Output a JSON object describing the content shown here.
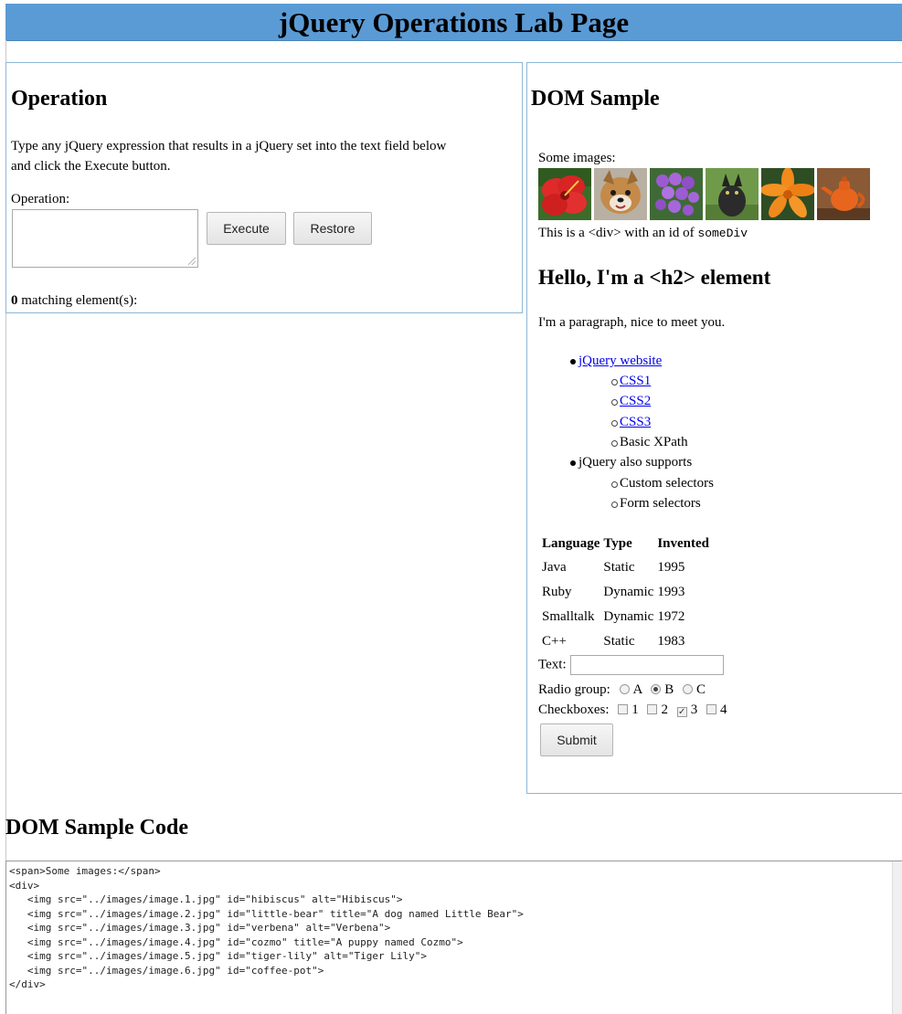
{
  "page": {
    "title": "jQuery Operations Lab Page"
  },
  "operation": {
    "heading": "Operation",
    "description": "Type any jQuery expression that results in a jQuery set into the text field below and click the Execute button.",
    "field_label": "Operation:",
    "field_value": "",
    "execute_label": "Execute",
    "restore_label": "Restore",
    "match_count": "0",
    "match_suffix": " matching element(s):"
  },
  "dom_sample": {
    "heading": "DOM Sample",
    "images_label": "Some images:",
    "images": [
      "hibiscus",
      "little-bear",
      "verbena",
      "cozmo",
      "tiger-lily",
      "coffee-pot"
    ],
    "div_text_prefix": "This is a <div> with an id of ",
    "div_id": "someDiv",
    "h2_text": "Hello, I'm a <h2> element",
    "paragraph": "I'm a paragraph, nice to meet you.",
    "list": {
      "item1": "jQuery website",
      "item1_children": [
        "CSS1",
        "CSS2",
        "CSS3",
        "Basic XPath"
      ],
      "item2": "jQuery also supports",
      "item2_children": [
        "Custom selectors",
        "Form selectors"
      ]
    },
    "table": {
      "headers": [
        "Language",
        "Type",
        "Invented"
      ],
      "rows": [
        [
          "Java",
          "Static",
          "1995"
        ],
        [
          "Ruby",
          "Dynamic",
          "1993"
        ],
        [
          "Smalltalk",
          "Dynamic",
          "1972"
        ],
        [
          "C++",
          "Static",
          "1983"
        ]
      ]
    },
    "form": {
      "text_label": "Text:",
      "text_value": "",
      "radio_label": "Radio group:",
      "radio_options": [
        "A",
        "B",
        "C"
      ],
      "radio_selected": "B",
      "checkbox_label": "Checkboxes:",
      "checkbox_options": [
        "1",
        "2",
        "3",
        "4"
      ],
      "checkbox_checked": [
        "3"
      ],
      "submit_label": "Submit"
    }
  },
  "code": {
    "heading": "DOM Sample Code",
    "lines": [
      "<span>Some images:</span>",
      "<div>",
      "   <img src=\"../images/image.1.jpg\" id=\"hibiscus\" alt=\"Hibiscus\">",
      "   <img src=\"../images/image.2.jpg\" id=\"little-bear\" title=\"A dog named Little Bear\">",
      "   <img src=\"../images/image.3.jpg\" id=\"verbena\" alt=\"Verbena\">",
      "   <img src=\"../images/image.4.jpg\" id=\"cozmo\" title=\"A puppy named Cozmo\">",
      "   <img src=\"../images/image.5.jpg\" id=\"tiger-lily\" alt=\"Tiger Lily\">",
      "   <img src=\"../images/image.6.jpg\" id=\"coffee-pot\">",
      "</div>"
    ]
  }
}
